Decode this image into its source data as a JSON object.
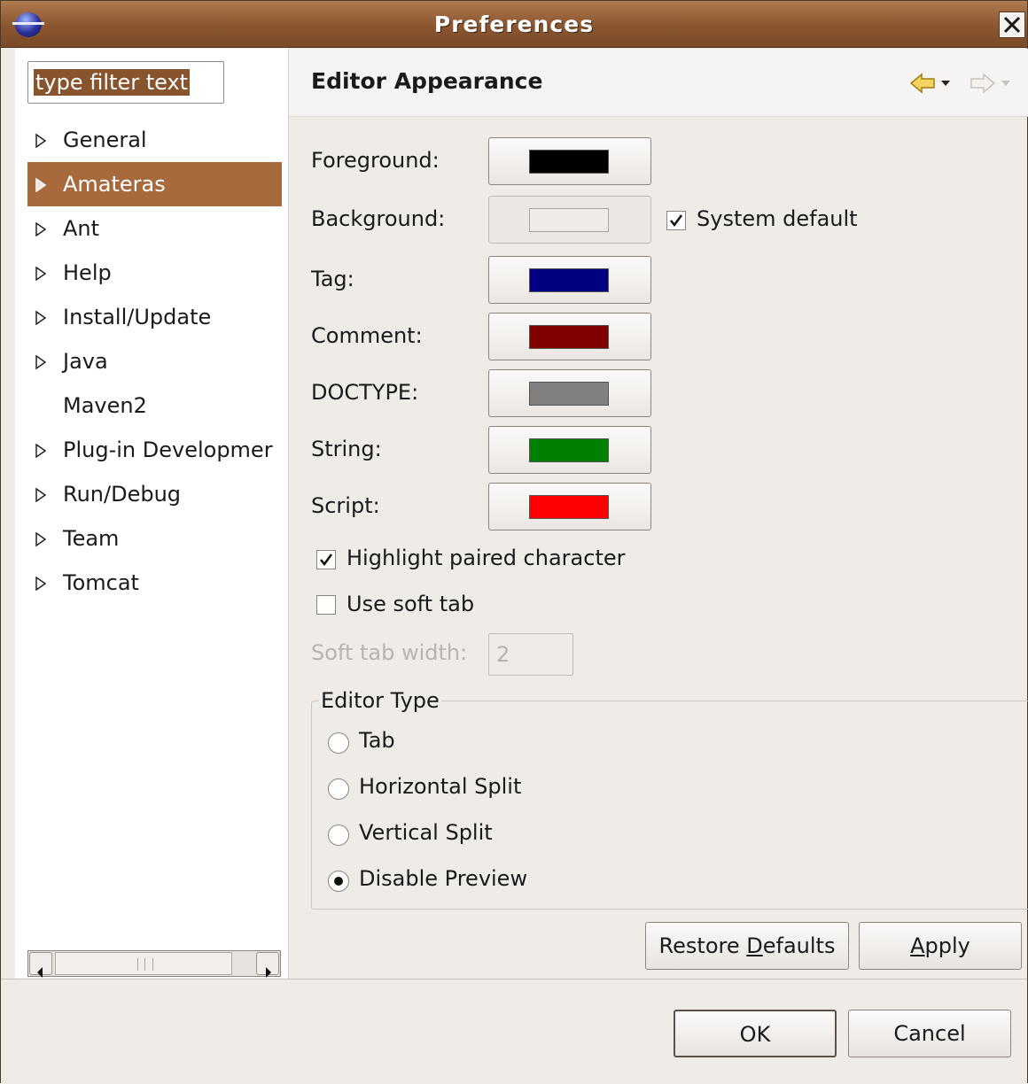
{
  "window": {
    "title": "Preferences",
    "close_symbol": "X"
  },
  "filter": {
    "value": "type filter text"
  },
  "tree": {
    "items": [
      {
        "label": "General",
        "expandable": true
      },
      {
        "label": "Amateras",
        "expandable": true,
        "selected": true
      },
      {
        "label": "Ant",
        "expandable": true
      },
      {
        "label": "Help",
        "expandable": true
      },
      {
        "label": "Install/Update",
        "expandable": true
      },
      {
        "label": "Java",
        "expandable": true
      },
      {
        "label": "Maven2",
        "expandable": false
      },
      {
        "label": "Plug-in Developmer",
        "expandable": true
      },
      {
        "label": "Run/Debug",
        "expandable": true
      },
      {
        "label": "Team",
        "expandable": true
      },
      {
        "label": "Tomcat",
        "expandable": true
      }
    ]
  },
  "page": {
    "title": "Editor Appearance",
    "colors": [
      {
        "label": "Foreground:",
        "color": "#000000"
      },
      {
        "label": "Background:",
        "color": "#efebe7"
      },
      {
        "label": "Tag:",
        "color": "#000080"
      },
      {
        "label": "Comment:",
        "color": "#800000"
      },
      {
        "label": "DOCTYPE:",
        "color": "#808080"
      },
      {
        "label": "String:",
        "color": "#008000"
      },
      {
        "label": "Script:",
        "color": "#ff0000"
      }
    ],
    "system_default": {
      "label": "System default",
      "checked": true
    },
    "highlight_paired": {
      "label": "Highlight paired character",
      "checked": true
    },
    "use_soft_tab": {
      "label": "Use soft tab",
      "checked": false
    },
    "soft_tab_width": {
      "label": "Soft tab width:",
      "value": "2"
    },
    "editor_type": {
      "legend": "Editor Type",
      "options": [
        "Tab",
        "Horizontal Split",
        "Vertical Split",
        "Disable Preview"
      ],
      "selected": "Disable Preview"
    },
    "restore_defaults": {
      "before": "Restore ",
      "mnemonic": "D",
      "after": "efaults"
    },
    "apply": {
      "before": "",
      "mnemonic": "A",
      "after": "pply"
    }
  },
  "dialog": {
    "ok": "OK",
    "cancel": "Cancel"
  },
  "theme": {
    "selection": "#a66a3d",
    "titlebar": "#8a5630"
  }
}
